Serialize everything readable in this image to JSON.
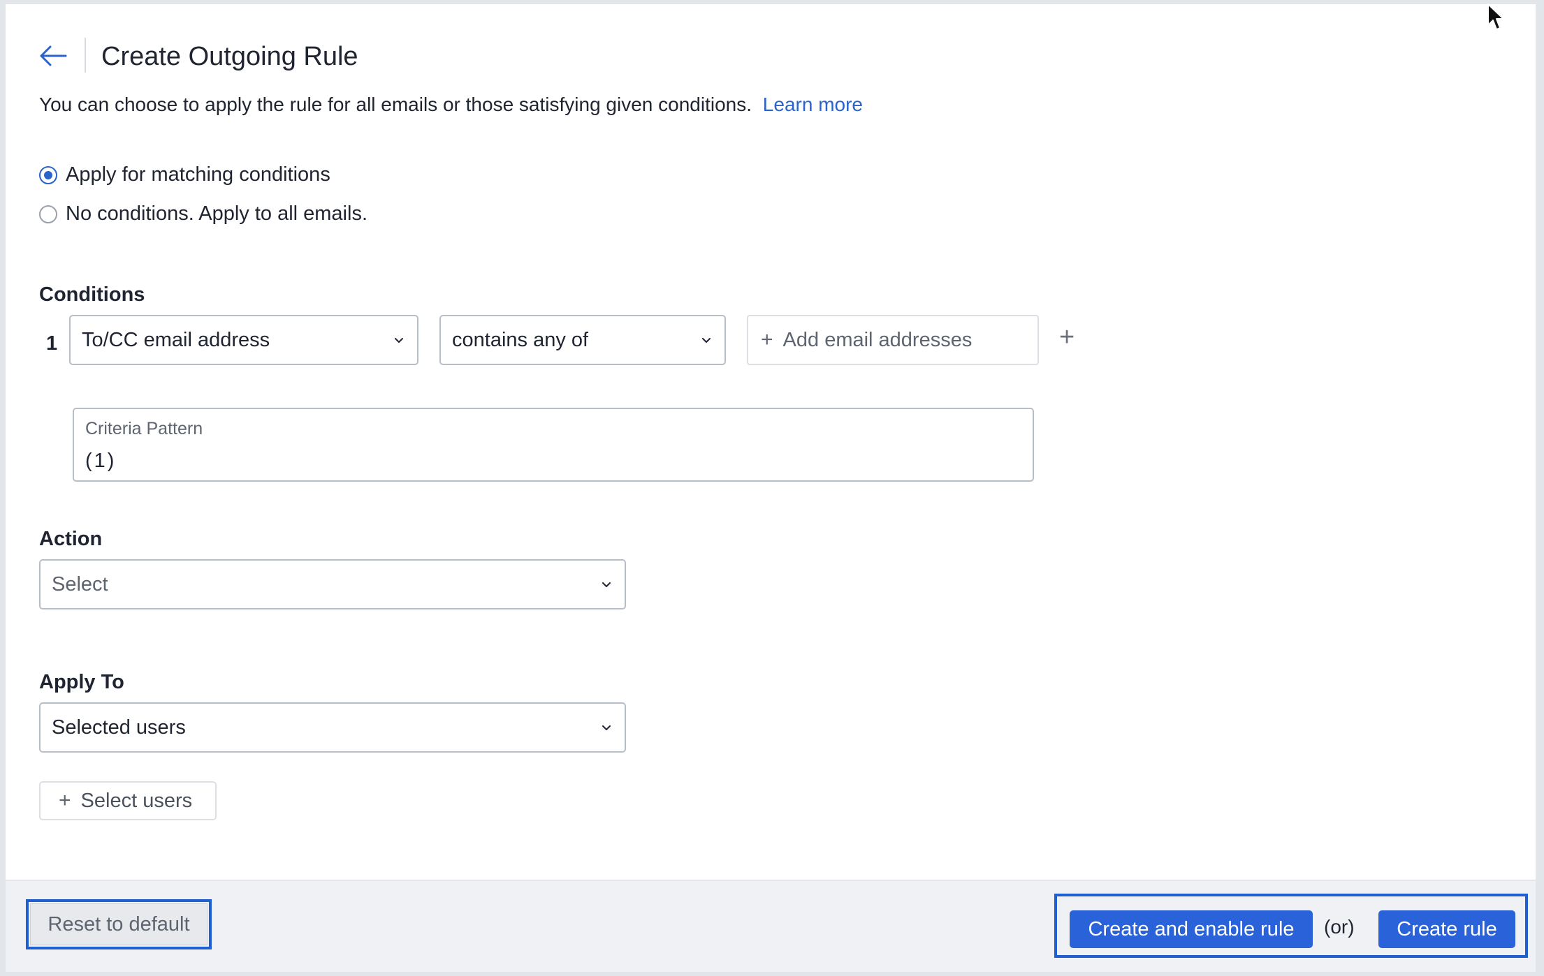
{
  "header": {
    "title": "Create Outgoing Rule",
    "description": "You can choose to apply the rule for all emails or those satisfying given conditions.",
    "learn_more": "Learn more"
  },
  "scope": {
    "options": [
      {
        "label": "Apply for matching conditions",
        "selected": true
      },
      {
        "label": "No conditions. Apply to all emails.",
        "selected": false
      }
    ]
  },
  "conditions": {
    "heading": "Conditions",
    "rows": [
      {
        "index": "1",
        "field": "To/CC email address",
        "operator": "contains any of",
        "value_placeholder": "Add email addresses"
      }
    ],
    "criteria_label": "Criteria Pattern",
    "criteria_value": "(1)"
  },
  "action": {
    "heading": "Action",
    "selected": "Select"
  },
  "apply_to": {
    "heading": "Apply To",
    "selected": "Selected users",
    "select_users_label": "Select users"
  },
  "footer": {
    "reset_label": "Reset to default",
    "create_enable_label": "Create and enable rule",
    "or_label": "(or)",
    "create_label": "Create rule"
  },
  "colors": {
    "accent": "#2a63d9",
    "link": "#2a63c9",
    "focus_outline": "#1f5fd1"
  }
}
